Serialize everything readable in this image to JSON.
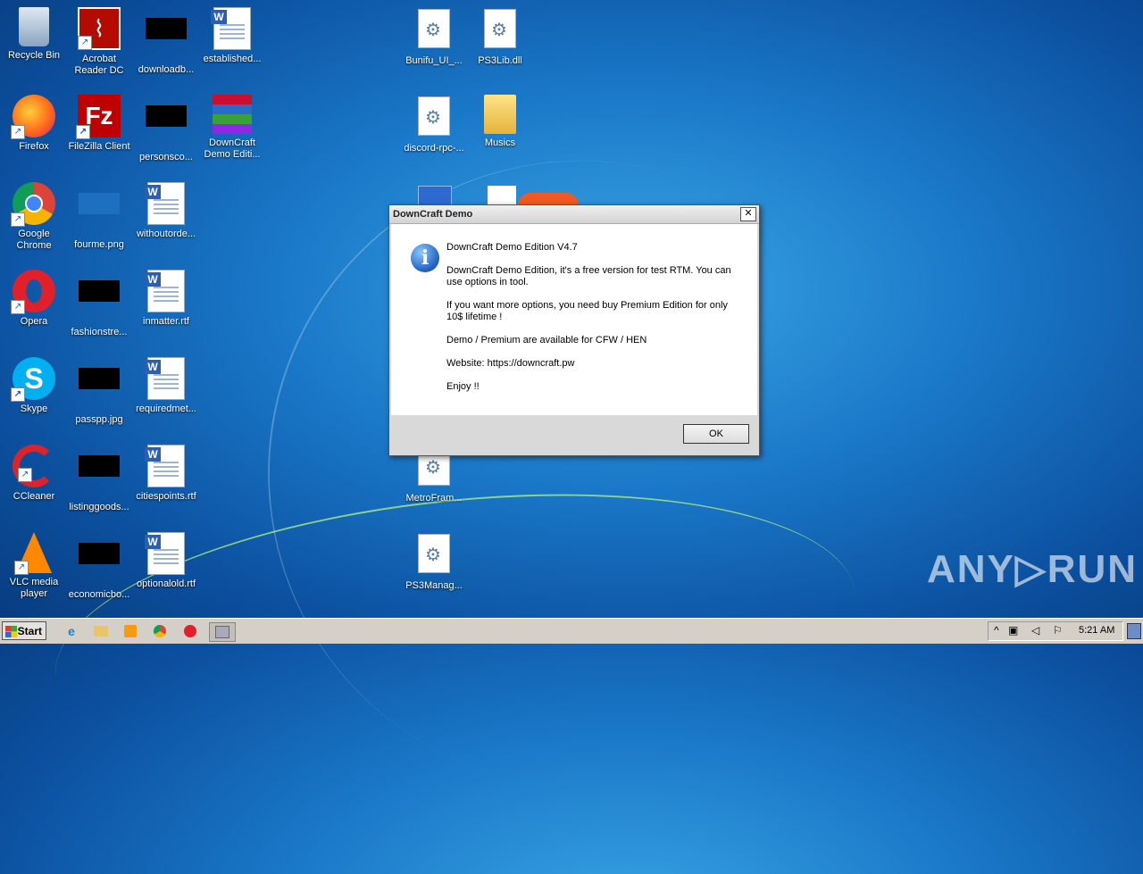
{
  "desktop": {
    "icons": [
      {
        "label": "Recycle Bin"
      },
      {
        "label": "Acrobat Reader DC"
      },
      {
        "label": "downloadb..."
      },
      {
        "label": "established..."
      },
      {
        "label": "Bunifu_UI_..."
      },
      {
        "label": "PS3Lib.dll"
      },
      {
        "label": "Firefox"
      },
      {
        "label": "FileZilla Client"
      },
      {
        "label": "personsco..."
      },
      {
        "label": "DownCraft Demo Editi..."
      },
      {
        "label": "discord-rpc-..."
      },
      {
        "label": "Musics"
      },
      {
        "label": "Google Chrome"
      },
      {
        "label": "fourme.png"
      },
      {
        "label": "withoutorde..."
      },
      {
        "label": "Opera"
      },
      {
        "label": "fashionstre..."
      },
      {
        "label": "inmatter.rtf"
      },
      {
        "label": "Skype"
      },
      {
        "label": "passpp.jpg"
      },
      {
        "label": "requiredmet..."
      },
      {
        "label": "CCleaner"
      },
      {
        "label": "listinggoods..."
      },
      {
        "label": "citiespoints.rtf"
      },
      {
        "label": "MetroFram..."
      },
      {
        "label": "VLC media player"
      },
      {
        "label": "economicbo..."
      },
      {
        "label": "optionalold.rtf"
      },
      {
        "label": "PS3Manag..."
      }
    ]
  },
  "dialog": {
    "title": "DownCraft Demo",
    "close": "✕",
    "lines": [
      "DownCraft Demo Edition V4.7",
      "DownCraft Demo Edition, it's a free version for test RTM. You can use options in tool.",
      "If you want more options, you need buy Premium Edition for only 10$ lifetime !",
      "Demo / Premium are available for CFW / HEN",
      "Website: https://downcraft.pw",
      "Enjoy !!"
    ],
    "ok_label": "OK"
  },
  "watermark": "ANY▷RUN",
  "taskbar": {
    "start_label": "Start",
    "clock": "5:21 AM"
  }
}
